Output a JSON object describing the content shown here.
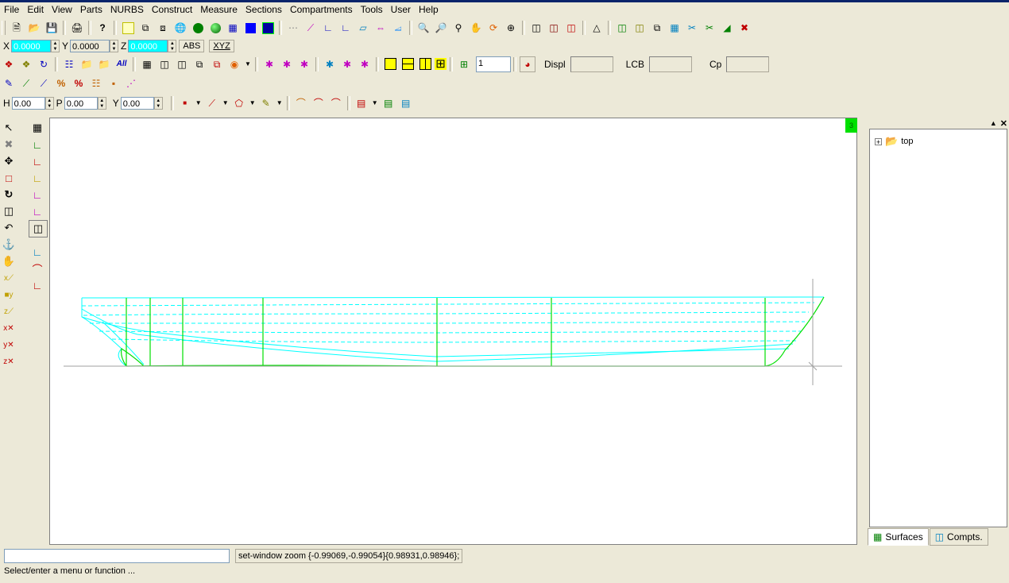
{
  "menu": [
    "File",
    "Edit",
    "View",
    "Parts",
    "NURBS",
    "Construct",
    "Measure",
    "Sections",
    "Compartments",
    "Tools",
    "User",
    "Help"
  ],
  "coords": {
    "x_label": "X",
    "x_value": "0.0000",
    "y_label": "Y",
    "y_value": "0.0000",
    "z_label": "Z",
    "z_value": "0.0000",
    "abs_label": "ABS",
    "xyz_label": "XYZ"
  },
  "hydro": {
    "count_value": "1",
    "displ_label": "Displ",
    "lcb_label": "LCB",
    "cp_label": "Cp"
  },
  "angles": {
    "h_label": "H",
    "h_value": "0.00",
    "p_label": "P",
    "p_value": "0.00",
    "y_label": "Y",
    "y_value": "0.00"
  },
  "canvas": {
    "badge": "3",
    "hull_color": "#00e000",
    "wave_color": "#00ffff"
  },
  "tree": {
    "root_label": "top",
    "expander": "+"
  },
  "tabs": [
    "Surfaces",
    "Compts."
  ],
  "status": {
    "command_echo": "set-window zoom {-0.99069,-0.99054}{0.98931,0.98946};",
    "prompt": "Select/enter a menu or function ..."
  }
}
